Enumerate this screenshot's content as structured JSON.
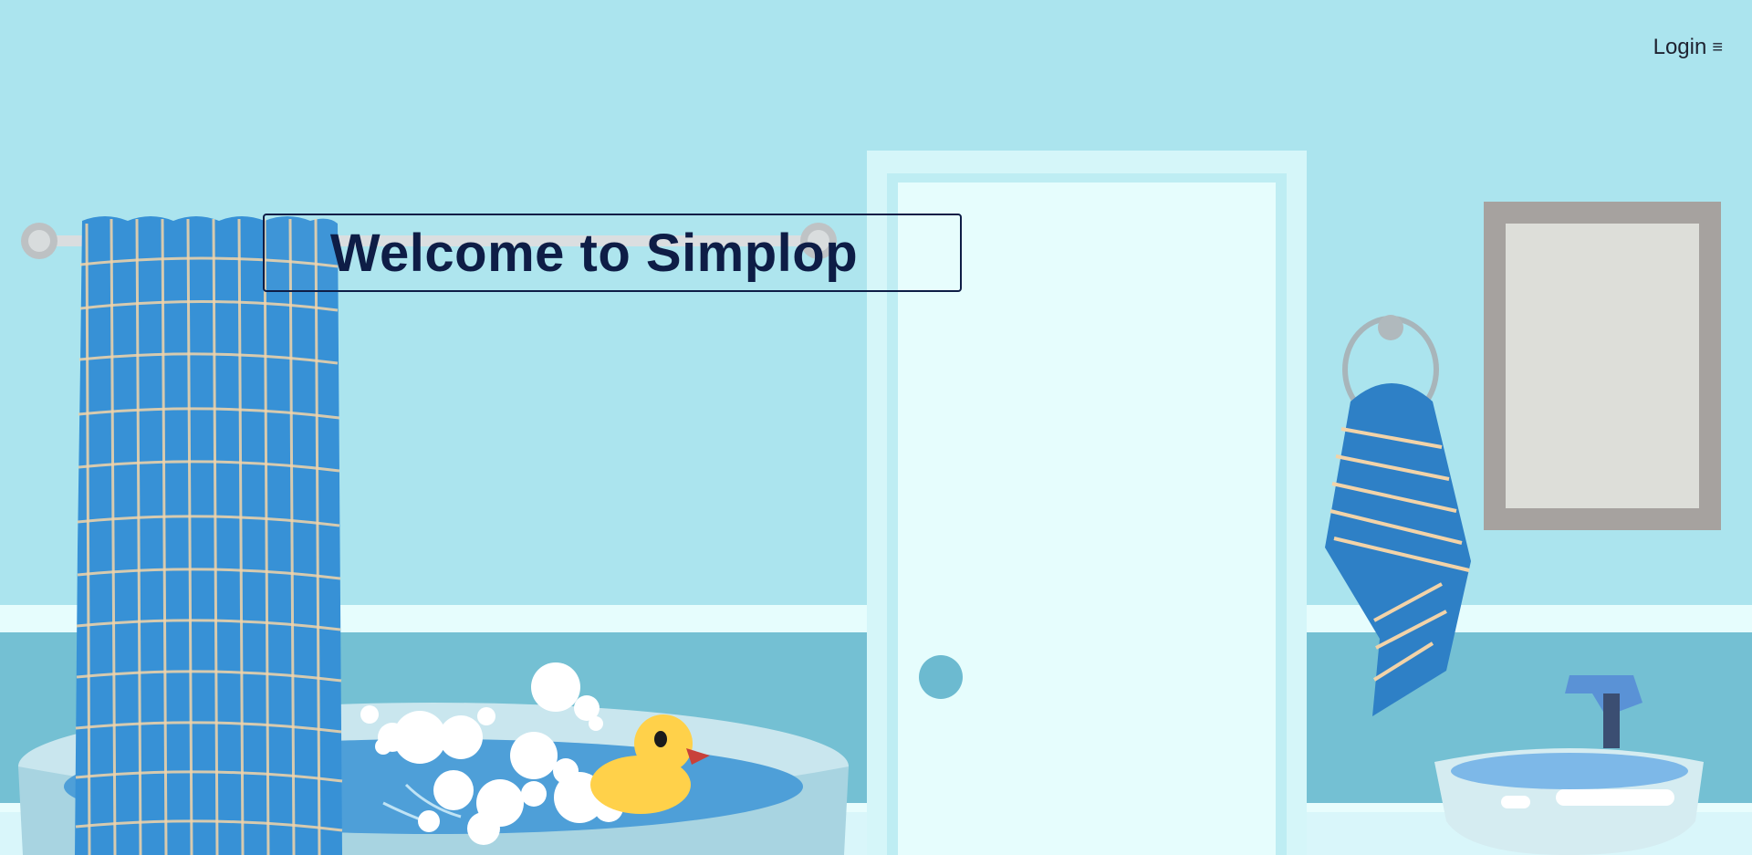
{
  "header": {
    "login_label": "Login",
    "menu_icon": "hamburger-icon",
    "menu_glyph": "≡"
  },
  "hero": {
    "title": "Welcome to Simplop"
  },
  "scene": {
    "description_icons": [
      "shower-curtain",
      "bathtub",
      "rubber-duck",
      "door",
      "towel-ring",
      "mirror",
      "sink"
    ],
    "colors": {
      "wall": "#ABE4EE",
      "wainscot": "#74C0D3",
      "door": "#E6FDFD",
      "curtain": "#3791D6",
      "duck": "#FFD14A",
      "title": "#0E1D46"
    }
  }
}
